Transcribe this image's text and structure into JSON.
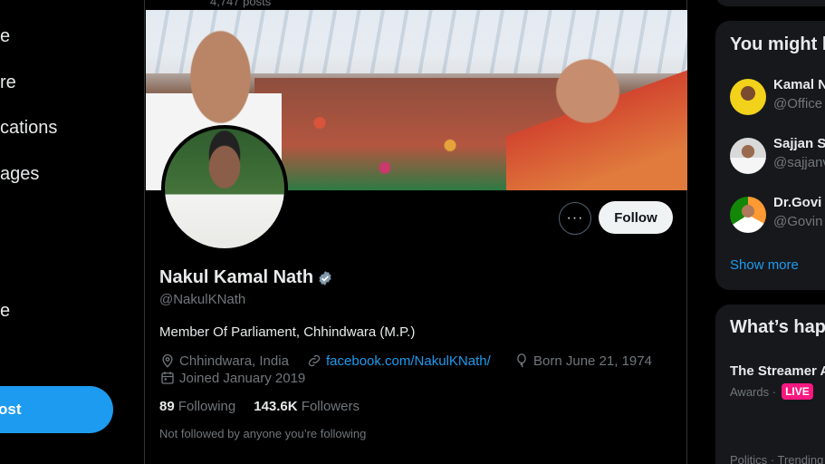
{
  "nav": {
    "items": [
      {
        "label": "e",
        "name": "home"
      },
      {
        "label": "re",
        "name": "explore"
      },
      {
        "label": "cations",
        "name": "notifications"
      },
      {
        "label": "ages",
        "name": "messages"
      },
      {
        "label": "e",
        "name": "profile"
      }
    ],
    "post_label": "ost"
  },
  "profile": {
    "posts_count": "4,747 posts",
    "name": "Nakul Kamal Nath",
    "handle": "@NakulKNath",
    "bio": "Member Of Parliament, Chhindwara (M.P.)",
    "location": "Chhindwara, India",
    "website": "facebook.com/NakulKNath/",
    "born": "Born June 21, 1974",
    "joined": "Joined January 2019",
    "following_count": "89",
    "following_label": "Following",
    "followers_count": "143.6K",
    "followers_label": "Followers",
    "not_followed": "Not followed by anyone you’re following",
    "follow_label": "Follow",
    "more_label": "···"
  },
  "sidebar": {
    "who_to_follow_title": "You might l",
    "suggestions": [
      {
        "name": "Kamal N",
        "handle": "@Office"
      },
      {
        "name": "Sajjan S",
        "handle": "@sajjanv"
      },
      {
        "name": "Dr.Govi",
        "handle": "@Govin"
      }
    ],
    "show_more": "Show more",
    "happening_title": "What’s hap",
    "trend_title": "The Streamer A",
    "trend_context": "Awards ·",
    "live_badge": "LIVE",
    "trend_category": "Politics · Trending"
  },
  "colors": {
    "accent": "#1d9bf0",
    "verified": "#829aab",
    "live": "#f91880"
  }
}
